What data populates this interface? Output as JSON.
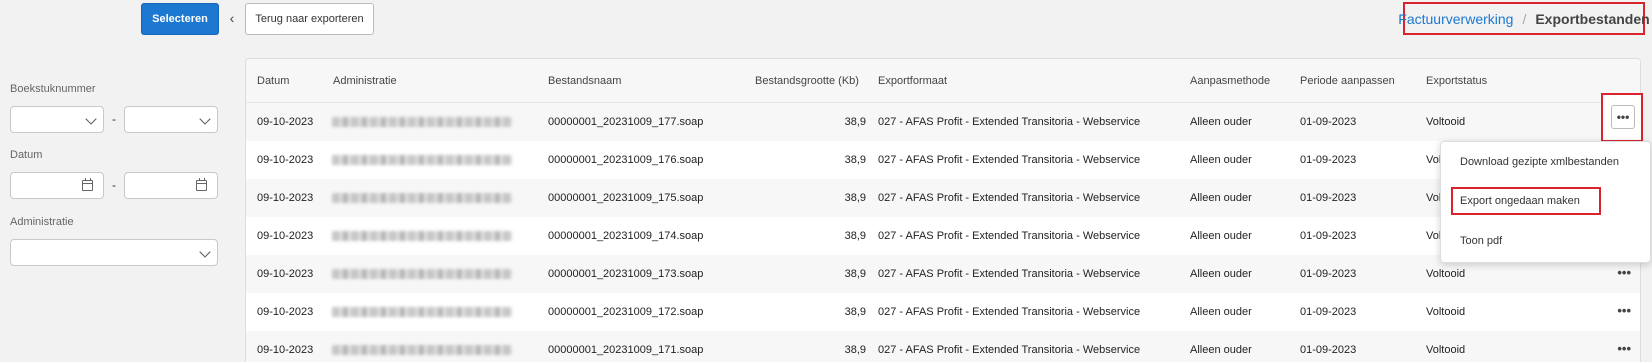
{
  "toolbar": {
    "select_label": "Selecteren",
    "back_label": "Terug naar exporteren"
  },
  "breadcrumb": {
    "parent": "Factuurverwerking",
    "separator": "/",
    "current": "Exportbestanden"
  },
  "filters": {
    "boekstuknummer_label": "Boekstuknummer",
    "datum_label": "Datum",
    "administratie_label": "Administratie",
    "range_separator": "-"
  },
  "table": {
    "columns": [
      "Datum",
      "Administratie",
      "Bestandsnaam",
      "Bestandsgrootte (Kb)",
      "Exportformaat",
      "Aanpasmethode",
      "Periode aanpassen",
      "Exportstatus"
    ],
    "rows": [
      {
        "datum": "09-10-2023",
        "bestandsnaam": "00000001_20231009_177.soap",
        "grootte": "38,9",
        "formaat": "027 - AFAS Profit - Extended Transitoria - Webservice",
        "methode": "Alleen ouder",
        "periode": "01-09-2023",
        "status": "Voltooid"
      },
      {
        "datum": "09-10-2023",
        "bestandsnaam": "00000001_20231009_176.soap",
        "grootte": "38,9",
        "formaat": "027 - AFAS Profit - Extended Transitoria - Webservice",
        "methode": "Alleen ouder",
        "periode": "01-09-2023",
        "status": "Voltooid"
      },
      {
        "datum": "09-10-2023",
        "bestandsnaam": "00000001_20231009_175.soap",
        "grootte": "38,9",
        "formaat": "027 - AFAS Profit - Extended Transitoria - Webservice",
        "methode": "Alleen ouder",
        "periode": "01-09-2023",
        "status": "Voltooid"
      },
      {
        "datum": "09-10-2023",
        "bestandsnaam": "00000001_20231009_174.soap",
        "grootte": "38,9",
        "formaat": "027 - AFAS Profit - Extended Transitoria - Webservice",
        "methode": "Alleen ouder",
        "periode": "01-09-2023",
        "status": "Voltooid"
      },
      {
        "datum": "09-10-2023",
        "bestandsnaam": "00000001_20231009_173.soap",
        "grootte": "38,9",
        "formaat": "027 - AFAS Profit - Extended Transitoria - Webservice",
        "methode": "Alleen ouder",
        "periode": "01-09-2023",
        "status": "Voltooid"
      },
      {
        "datum": "09-10-2023",
        "bestandsnaam": "00000001_20231009_172.soap",
        "grootte": "38,9",
        "formaat": "027 - AFAS Profit - Extended Transitoria - Webservice",
        "methode": "Alleen ouder",
        "periode": "01-09-2023",
        "status": "Voltooid"
      },
      {
        "datum": "09-10-2023",
        "bestandsnaam": "00000001_20231009_171.soap",
        "grootte": "38,9",
        "formaat": "027 - AFAS Profit - Extended Transitoria - Webservice",
        "methode": "Alleen ouder",
        "periode": "01-09-2023",
        "status": "Voltooid"
      }
    ],
    "row_menu_glyph": "•••"
  },
  "dropdown": {
    "items": [
      "Download gezipte xmlbestanden",
      "Export ongedaan maken",
      "Toon pdf"
    ]
  },
  "colors": {
    "primary": "#1c78d0",
    "highlight": "#d9232d"
  }
}
